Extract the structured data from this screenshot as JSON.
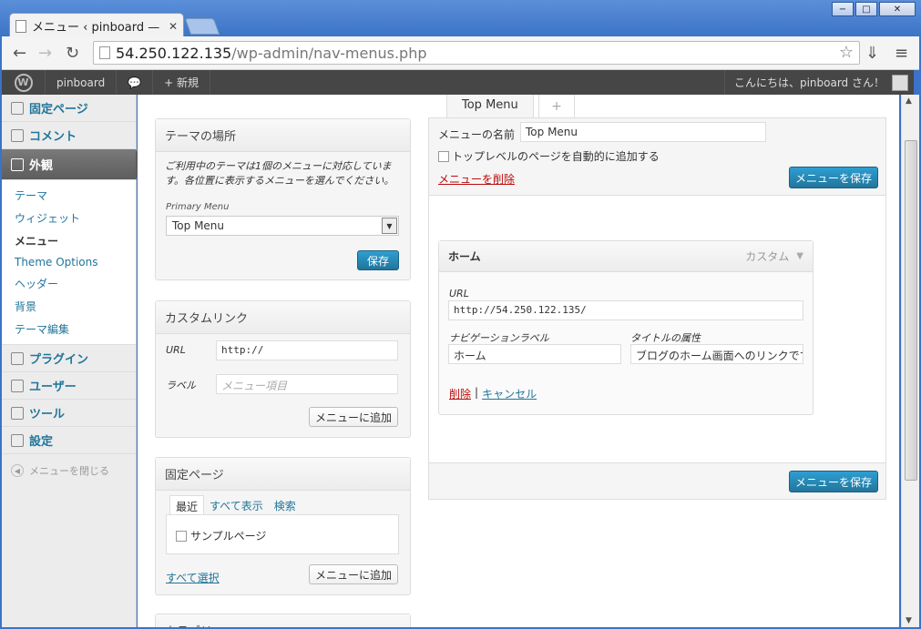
{
  "browser": {
    "tab_title": "メニュー ‹ pinboard — V",
    "url_host": "54.250.122.135",
    "url_path": "/wp-admin/nav-menus.php",
    "window_buttons": [
      "−",
      "□",
      "✕"
    ]
  },
  "adminbar": {
    "site_name": "pinboard",
    "new_label": "+ 新規",
    "greeting": "こんにちは、pinboard さん！"
  },
  "sidebar": {
    "items_top": [
      {
        "label": "固定ページ"
      },
      {
        "label": "コメント"
      }
    ],
    "active": {
      "label": "外観"
    },
    "submenu": [
      "テーマ",
      "ウィジェット",
      "メニュー",
      "Theme Options",
      "ヘッダー",
      "背景",
      "テーマ編集"
    ],
    "items_bottom": [
      {
        "label": "プラグイン"
      },
      {
        "label": "ユーザー"
      },
      {
        "label": "ツール"
      },
      {
        "label": "設定"
      }
    ],
    "collapse_label": "メニューを閉じる"
  },
  "theme_locations": {
    "title": "テーマの場所",
    "note": "ご利用中のテーマは1個のメニューに対応しています。各位置に表示するメニューを選んでください。",
    "field_label": "Primary Menu",
    "selected": "Top Menu",
    "save_label": "保存"
  },
  "custom_links": {
    "title": "カスタムリンク",
    "url_label": "URL",
    "url_value": "http://",
    "label_label": "ラベル",
    "label_placeholder": "メニュー項目",
    "add_label": "メニューに追加"
  },
  "pages": {
    "title": "固定ページ",
    "tabs": [
      "最近",
      "すべて表示",
      "検索"
    ],
    "item": "サンプルページ",
    "select_all": "すべて選択",
    "add_label": "メニューに追加",
    "next_title": "カテゴリー"
  },
  "menu": {
    "tab_label": "Top Menu",
    "plus_label": "+",
    "name_label": "メニューの名前",
    "name_value": "Top Menu",
    "auto_add_label": "トップレベルのページを自動的に追加する",
    "delete_label": "メニューを削除",
    "save_label": "メニューを保存"
  },
  "menu_item": {
    "title": "ホーム",
    "type": "カスタム",
    "url_label": "URL",
    "url_value": "http://54.250.122.135/",
    "nav_label_label": "ナビゲーションラベル",
    "nav_label_value": "ホーム",
    "title_attr_label": "タイトルの属性",
    "title_attr_value": "ブログのホーム画面へのリンクです",
    "remove_label": "削除",
    "separator": "|",
    "cancel_label": "キャンセル"
  }
}
